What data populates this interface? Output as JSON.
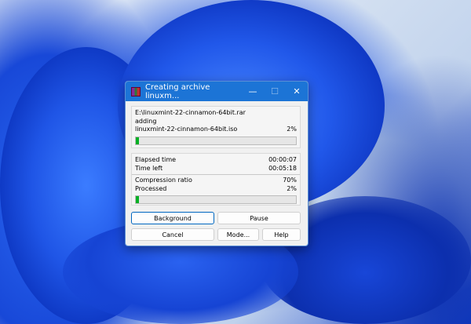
{
  "window": {
    "title": "Creating archive linuxm...",
    "minimize": "—",
    "maximize": "☐",
    "close": "✕"
  },
  "archive": {
    "path": "E:\\linuxmint-22-cinnamon-64bit.rar",
    "action": "adding",
    "file": "linuxmint-22-cinnamon-64bit.iso",
    "file_percent": "2%",
    "file_progress": 2
  },
  "timing": {
    "elapsed_label": "Elapsed time",
    "elapsed": "00:00:07",
    "left_label": "Time left",
    "left": "00:05:18"
  },
  "stats": {
    "ratio_label": "Compression ratio",
    "ratio": "70%",
    "processed_label": "Processed",
    "processed": "2%",
    "processed_progress": 2
  },
  "buttons": {
    "background": "Background",
    "pause": "Pause",
    "cancel": "Cancel",
    "mode": "Mode...",
    "help": "Help"
  },
  "colors": {
    "title_bar": "#1c74d6",
    "progress": "#06b025"
  }
}
